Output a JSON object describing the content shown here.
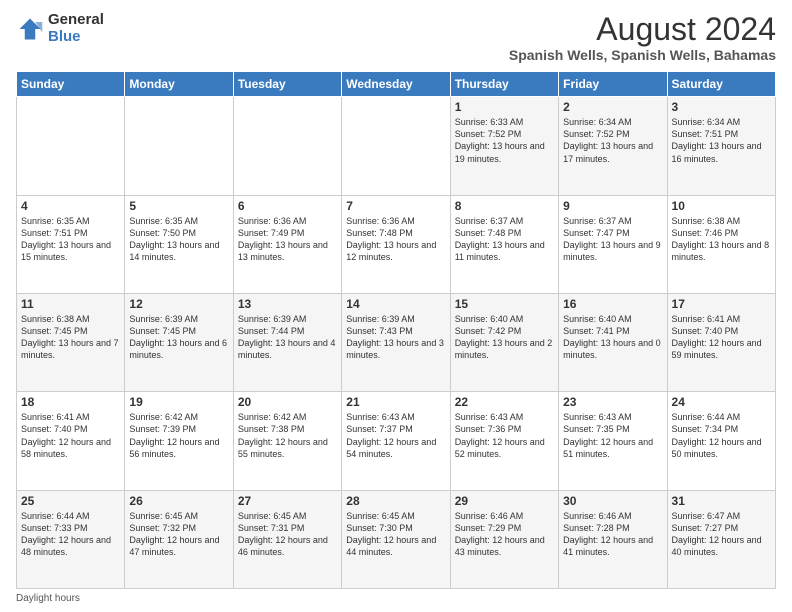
{
  "logo": {
    "general": "General",
    "blue": "Blue"
  },
  "title": "August 2024",
  "subtitle": "Spanish Wells, Spanish Wells, Bahamas",
  "days_of_week": [
    "Sunday",
    "Monday",
    "Tuesday",
    "Wednesday",
    "Thursday",
    "Friday",
    "Saturday"
  ],
  "footer_label": "Daylight hours",
  "weeks": [
    [
      {
        "day": "",
        "info": ""
      },
      {
        "day": "",
        "info": ""
      },
      {
        "day": "",
        "info": ""
      },
      {
        "day": "",
        "info": ""
      },
      {
        "day": "1",
        "info": "Sunrise: 6:33 AM\nSunset: 7:52 PM\nDaylight: 13 hours and 19 minutes."
      },
      {
        "day": "2",
        "info": "Sunrise: 6:34 AM\nSunset: 7:52 PM\nDaylight: 13 hours and 17 minutes."
      },
      {
        "day": "3",
        "info": "Sunrise: 6:34 AM\nSunset: 7:51 PM\nDaylight: 13 hours and 16 minutes."
      }
    ],
    [
      {
        "day": "4",
        "info": "Sunrise: 6:35 AM\nSunset: 7:51 PM\nDaylight: 13 hours and 15 minutes."
      },
      {
        "day": "5",
        "info": "Sunrise: 6:35 AM\nSunset: 7:50 PM\nDaylight: 13 hours and 14 minutes."
      },
      {
        "day": "6",
        "info": "Sunrise: 6:36 AM\nSunset: 7:49 PM\nDaylight: 13 hours and 13 minutes."
      },
      {
        "day": "7",
        "info": "Sunrise: 6:36 AM\nSunset: 7:48 PM\nDaylight: 13 hours and 12 minutes."
      },
      {
        "day": "8",
        "info": "Sunrise: 6:37 AM\nSunset: 7:48 PM\nDaylight: 13 hours and 11 minutes."
      },
      {
        "day": "9",
        "info": "Sunrise: 6:37 AM\nSunset: 7:47 PM\nDaylight: 13 hours and 9 minutes."
      },
      {
        "day": "10",
        "info": "Sunrise: 6:38 AM\nSunset: 7:46 PM\nDaylight: 13 hours and 8 minutes."
      }
    ],
    [
      {
        "day": "11",
        "info": "Sunrise: 6:38 AM\nSunset: 7:45 PM\nDaylight: 13 hours and 7 minutes."
      },
      {
        "day": "12",
        "info": "Sunrise: 6:39 AM\nSunset: 7:45 PM\nDaylight: 13 hours and 6 minutes."
      },
      {
        "day": "13",
        "info": "Sunrise: 6:39 AM\nSunset: 7:44 PM\nDaylight: 13 hours and 4 minutes."
      },
      {
        "day": "14",
        "info": "Sunrise: 6:39 AM\nSunset: 7:43 PM\nDaylight: 13 hours and 3 minutes."
      },
      {
        "day": "15",
        "info": "Sunrise: 6:40 AM\nSunset: 7:42 PM\nDaylight: 13 hours and 2 minutes."
      },
      {
        "day": "16",
        "info": "Sunrise: 6:40 AM\nSunset: 7:41 PM\nDaylight: 13 hours and 0 minutes."
      },
      {
        "day": "17",
        "info": "Sunrise: 6:41 AM\nSunset: 7:40 PM\nDaylight: 12 hours and 59 minutes."
      }
    ],
    [
      {
        "day": "18",
        "info": "Sunrise: 6:41 AM\nSunset: 7:40 PM\nDaylight: 12 hours and 58 minutes."
      },
      {
        "day": "19",
        "info": "Sunrise: 6:42 AM\nSunset: 7:39 PM\nDaylight: 12 hours and 56 minutes."
      },
      {
        "day": "20",
        "info": "Sunrise: 6:42 AM\nSunset: 7:38 PM\nDaylight: 12 hours and 55 minutes."
      },
      {
        "day": "21",
        "info": "Sunrise: 6:43 AM\nSunset: 7:37 PM\nDaylight: 12 hours and 54 minutes."
      },
      {
        "day": "22",
        "info": "Sunrise: 6:43 AM\nSunset: 7:36 PM\nDaylight: 12 hours and 52 minutes."
      },
      {
        "day": "23",
        "info": "Sunrise: 6:43 AM\nSunset: 7:35 PM\nDaylight: 12 hours and 51 minutes."
      },
      {
        "day": "24",
        "info": "Sunrise: 6:44 AM\nSunset: 7:34 PM\nDaylight: 12 hours and 50 minutes."
      }
    ],
    [
      {
        "day": "25",
        "info": "Sunrise: 6:44 AM\nSunset: 7:33 PM\nDaylight: 12 hours and 48 minutes."
      },
      {
        "day": "26",
        "info": "Sunrise: 6:45 AM\nSunset: 7:32 PM\nDaylight: 12 hours and 47 minutes."
      },
      {
        "day": "27",
        "info": "Sunrise: 6:45 AM\nSunset: 7:31 PM\nDaylight: 12 hours and 46 minutes."
      },
      {
        "day": "28",
        "info": "Sunrise: 6:45 AM\nSunset: 7:30 PM\nDaylight: 12 hours and 44 minutes."
      },
      {
        "day": "29",
        "info": "Sunrise: 6:46 AM\nSunset: 7:29 PM\nDaylight: 12 hours and 43 minutes."
      },
      {
        "day": "30",
        "info": "Sunrise: 6:46 AM\nSunset: 7:28 PM\nDaylight: 12 hours and 41 minutes."
      },
      {
        "day": "31",
        "info": "Sunrise: 6:47 AM\nSunset: 7:27 PM\nDaylight: 12 hours and 40 minutes."
      }
    ]
  ]
}
